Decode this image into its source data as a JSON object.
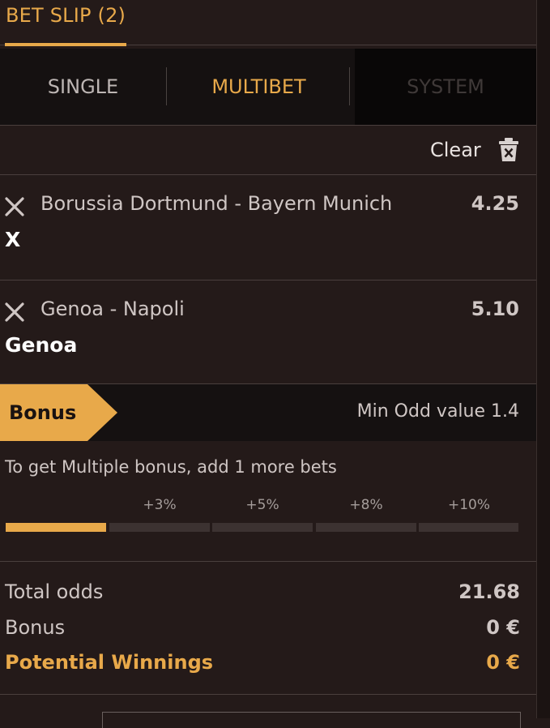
{
  "header": {
    "title": "BET SLIP (2)"
  },
  "tabs": [
    {
      "label": "SINGLE",
      "state": "inactive"
    },
    {
      "label": "MULTIBET",
      "state": "active"
    },
    {
      "label": "SYSTEM",
      "state": "disabled"
    }
  ],
  "actions": {
    "clear_label": "Clear",
    "clear_icon": "trash-icon"
  },
  "bets": [
    {
      "match": "Borussia Dortmund - Bayern Munich",
      "odd": "4.25",
      "pick": "X"
    },
    {
      "match": "Genoa - Napoli",
      "odd": "5.10",
      "pick": "Genoa"
    }
  ],
  "bonus": {
    "tag": "Bonus",
    "min_odd": "Min Odd value 1.4",
    "hint": "To get Multiple bonus, add 1 more bets",
    "steps": [
      "+3%",
      "+5%",
      "+8%",
      "+10%"
    ],
    "progress_segments_filled": 1,
    "progress_segments_total": 5
  },
  "totals": {
    "total_odds_label": "Total odds",
    "total_odds_value": "21.68",
    "bonus_label": "Bonus",
    "bonus_value": "0 €",
    "winnings_label": "Potential Winnings",
    "winnings_value": "0 €"
  },
  "colors": {
    "accent": "#e8a94a",
    "background": "#241a19",
    "tabs_bg": "#151111"
  }
}
